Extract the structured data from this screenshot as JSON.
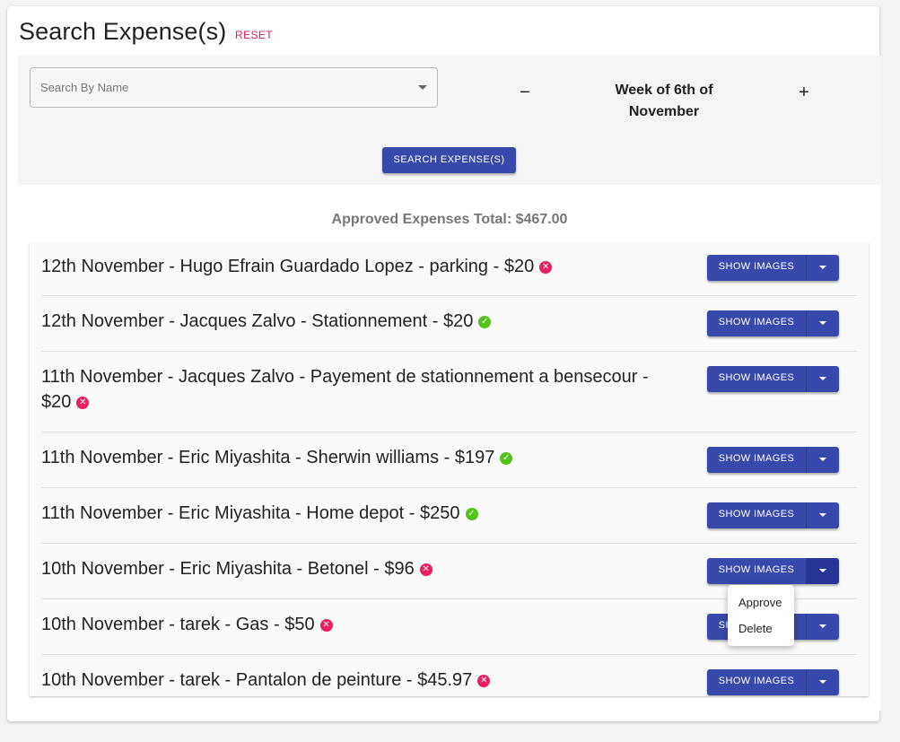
{
  "header": {
    "title": "Search Expense(s)",
    "reset_label": "RESET"
  },
  "search": {
    "name_placeholder": "Search By Name",
    "minus_label": "−",
    "plus_label": "+",
    "week_line1": "Week of 6th of",
    "week_line2": "November",
    "search_button": "SEARCH EXPENSE(S)"
  },
  "summary": {
    "approved_total": "Approved Expenses Total: $467.00"
  },
  "status_icons": {
    "approved": "check-circle-icon",
    "rejected": "x-circle-icon"
  },
  "colors": {
    "primary": "#3949ab",
    "accent": "#d81b60",
    "approved": "#52c41a",
    "rejected": "#e91e63"
  },
  "expenses": [
    {
      "text": "12th November - Hugo Efrain Guardado Lopez - parking - $20",
      "status": "rejected",
      "button": "SHOW IMAGES"
    },
    {
      "text": "12th November - Jacques Zalvo - Stationnement - $20",
      "status": "approved",
      "button": "SHOW IMAGES"
    },
    {
      "text": "11th November - Jacques Zalvo - Payement de stationnement a bensecour - $20",
      "status": "rejected",
      "button": "SHOW IMAGES"
    },
    {
      "text": "11th November - Eric Miyashita - Sherwin williams - $197",
      "status": "approved",
      "button": "SHOW IMAGES"
    },
    {
      "text": "11th November - Eric Miyashita - Home depot - $250",
      "status": "approved",
      "button": "SHOW IMAGES"
    },
    {
      "text": "10th November - Eric Miyashita - Betonel - $96",
      "status": "rejected",
      "button": "SHOW IMAGES"
    },
    {
      "text": "10th November - tarek - Gas - $50",
      "status": "rejected",
      "button": "SHOW IMAGES"
    },
    {
      "text": "10th November - tarek - Pantalon de peinture - $45.97",
      "status": "rejected",
      "button": "SHOW IMAGES"
    }
  ],
  "dropdown_menu": {
    "approve": "Approve",
    "delete": "Delete"
  }
}
